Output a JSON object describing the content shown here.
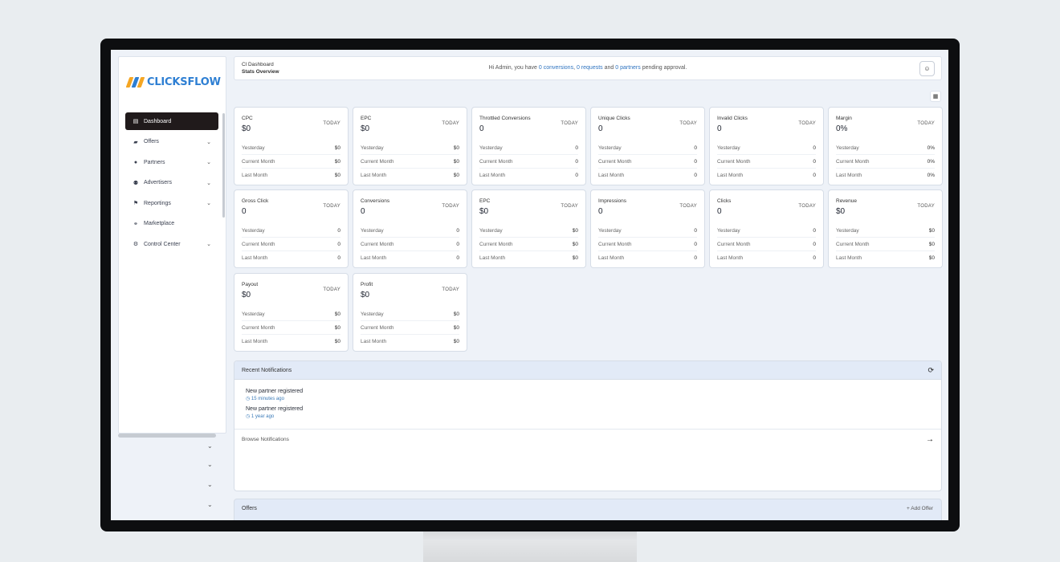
{
  "brand": {
    "name": "CLICKSFLOW",
    "colors": [
      "#f5a623",
      "#2e7fd3",
      "#f5a623"
    ]
  },
  "sidebar": {
    "items": [
      {
        "label": "Dashboard",
        "icon": "dashboard-icon",
        "glyph": "▤",
        "active": true,
        "chevron": false
      },
      {
        "label": "Offers",
        "icon": "folder-icon",
        "glyph": "▰",
        "active": false,
        "chevron": true
      },
      {
        "label": "Partners",
        "icon": "user-icon",
        "glyph": "●",
        "active": false,
        "chevron": true
      },
      {
        "label": "Advertisers",
        "icon": "users-icon",
        "glyph": "⚉",
        "active": false,
        "chevron": true
      },
      {
        "label": "Reportings",
        "icon": "chart-icon",
        "glyph": "⚑",
        "active": false,
        "chevron": true
      },
      {
        "label": "Marketplace",
        "icon": "link-icon",
        "glyph": "⚭",
        "active": false,
        "chevron": false
      },
      {
        "label": "Control Center",
        "icon": "gear-icon",
        "glyph": "⚙",
        "active": false,
        "chevron": true
      }
    ],
    "chevron_glyph": "⌄"
  },
  "header": {
    "crumb_top": "Cl Dashboard",
    "crumb_sub": "Stats Overview",
    "greeting_prefix": "Hi Admin, you have ",
    "greeting_link1": "0 conversions",
    "greeting_sep": ", ",
    "greeting_link2": "0 requests",
    "greeting_and": " and ",
    "greeting_link3": "0 partners",
    "greeting_suffix": " pending approval.",
    "button_icon": "profile-icon"
  },
  "stats": {
    "row_labels": [
      "Yesterday",
      "Current Month",
      "Last Month"
    ],
    "period_label": "TODAY",
    "cards": [
      {
        "title": "CPC",
        "value": "$0",
        "rows": [
          "$0",
          "$0",
          "$0"
        ]
      },
      {
        "title": "EPC",
        "value": "$0",
        "rows": [
          "$0",
          "$0",
          "$0"
        ]
      },
      {
        "title": "Throttled Conversions",
        "value": "0",
        "rows": [
          "0",
          "0",
          "0"
        ]
      },
      {
        "title": "Unique Clicks",
        "value": "0",
        "rows": [
          "0",
          "0",
          "0"
        ]
      },
      {
        "title": "Invalid Clicks",
        "value": "0",
        "rows": [
          "0",
          "0",
          "0"
        ]
      },
      {
        "title": "Margin",
        "value": "0%",
        "rows": [
          "0%",
          "0%",
          "0%"
        ]
      },
      {
        "title": "Gross Click",
        "value": "0",
        "rows": [
          "0",
          "0",
          "0"
        ]
      },
      {
        "title": "Conversions",
        "value": "0",
        "rows": [
          "0",
          "0",
          "0"
        ]
      },
      {
        "title": "EPC",
        "value": "$0",
        "rows": [
          "$0",
          "$0",
          "$0"
        ]
      },
      {
        "title": "Impressions",
        "value": "0",
        "rows": [
          "0",
          "0",
          "0"
        ]
      },
      {
        "title": "Clicks",
        "value": "0",
        "rows": [
          "0",
          "0",
          "0"
        ]
      },
      {
        "title": "Revenue",
        "value": "$0",
        "rows": [
          "$0",
          "$0",
          "$0"
        ]
      },
      {
        "title": "Payout",
        "value": "$0",
        "rows": [
          "$0",
          "$0",
          "$0"
        ]
      },
      {
        "title": "Profit",
        "value": "$0",
        "rows": [
          "$0",
          "$0",
          "$0"
        ]
      }
    ]
  },
  "notifications": {
    "title": "Recent Notifications",
    "items": [
      {
        "title": "New partner registered",
        "time": "15 minutes ago"
      },
      {
        "title": "New partner registered",
        "time": "1 year ago"
      }
    ],
    "browse": "Browse Notifications"
  },
  "offers": {
    "title": "Offers",
    "add": "+ Add Offer"
  }
}
